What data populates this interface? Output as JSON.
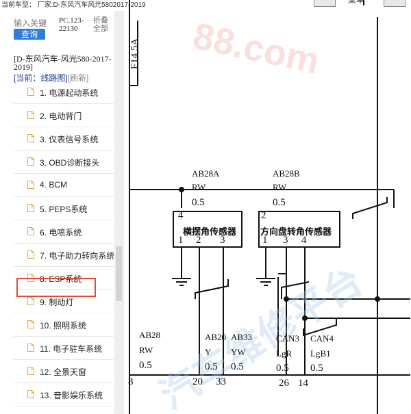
{
  "header": {
    "title": "当前车型：  厂家:D-东风汽车风光5802017-2019",
    "right_label": "菜单"
  },
  "sidebar": {
    "search": {
      "placeholder": "输入关键",
      "button": "查询"
    },
    "pc_code": "PC.123-22130",
    "fold": "折叠全部",
    "vehicle": "[D-东风汽车-风光580-2017-2019]",
    "current": "[当前：线路图]",
    "refresh": "[刷新]",
    "items": [
      {
        "label": "1. 电源起动系统"
      },
      {
        "label": "2. 电动背门"
      },
      {
        "label": "3. 仪表信号系统"
      },
      {
        "label": "3. OBD诊断接头"
      },
      {
        "label": "4. BCM"
      },
      {
        "label": "5. PEPS系统"
      },
      {
        "label": "6. 电喷系统"
      },
      {
        "label": "7. 电子助力转向系统"
      },
      {
        "label": "8. ESP系统"
      },
      {
        "label": "9. 制动灯"
      },
      {
        "label": "10. 照明系统"
      },
      {
        "label": "11. 电子驻车系统"
      },
      {
        "label": "12. 全景天窗"
      },
      {
        "label": "13. 音影娱乐系统"
      }
    ]
  },
  "diagram": {
    "fuse": "F14 5A",
    "watermark_top": "88.com",
    "watermark_bottom": "汽车维修平台",
    "connector_a": {
      "name": "AB28A",
      "color": "RW",
      "size": "0.5",
      "pin": "4"
    },
    "connector_b": {
      "name": "AB28B",
      "color": "RW",
      "size": "0.5",
      "pin": "2"
    },
    "sensor_a": {
      "label": "横摆角传感器",
      "pins": [
        "1",
        "2",
        "3"
      ]
    },
    "sensor_b": {
      "label": "方向盘转角传感器",
      "pins": [
        "1",
        "3",
        "4"
      ]
    },
    "wires": [
      {
        "name": "AB28",
        "color": "RW",
        "size": "0.5",
        "pin": "8"
      },
      {
        "name": "AB20",
        "color": "Y",
        "size": "0.5",
        "pin": "20"
      },
      {
        "name": "AB33",
        "color": "YW",
        "size": "0.5",
        "pin": "33"
      },
      {
        "name": "CAN3",
        "color": "LgR",
        "size": "0.5",
        "pin": "26"
      },
      {
        "name": "CAN4",
        "color": "LgB1",
        "size": "0.5",
        "pin": "14"
      }
    ]
  }
}
